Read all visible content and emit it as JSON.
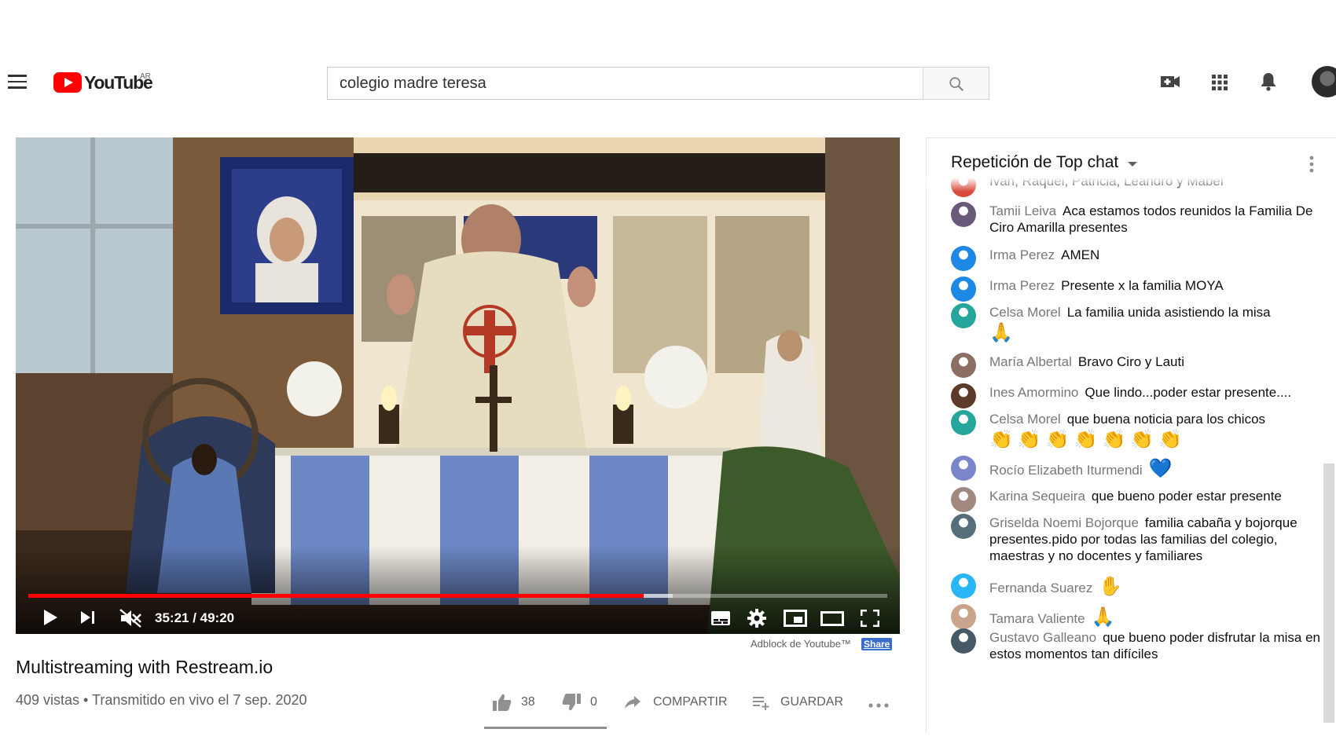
{
  "masthead": {
    "logo_text": "YouTube",
    "logo_country": "AR",
    "search_value": "colegio madre teresa"
  },
  "player": {
    "time_label": "35:21 / 49:20",
    "progress_fraction": 0.7166,
    "buffer_fraction": 0.75,
    "muted": true
  },
  "below_player": {
    "adblock_text": "Adblock de Youtube™",
    "share_text": "Share",
    "title": "Multistreaming with Restream.io",
    "meta": "409 vistas • Transmitido en vivo el 7 sep. 2020",
    "likes": "38",
    "dislikes": "0",
    "share_label": "COMPARTIR",
    "save_label": "GUARDAR"
  },
  "chat": {
    "title": "Repetición de Top chat",
    "messages": [
      {
        "author": "",
        "text": "Iván, Raquel, Patricia, Leandro y Mabel",
        "avatar_color": "#d84a3a",
        "emoji": ""
      },
      {
        "author": "Tamii Leiva",
        "text": "Aca estamos todos reunidos la Familia De Ciro Amarilla presentes",
        "avatar_color": "#6a5a7a",
        "emoji": ""
      },
      {
        "author": "Irma Perez",
        "text": "AMEN",
        "avatar_color": "#1e88e5",
        "emoji": ""
      },
      {
        "author": "Irma Perez",
        "text": "Presente x la familia MOYA",
        "avatar_color": "#1e88e5",
        "emoji": ""
      },
      {
        "author": "Celsa Morel",
        "text": "La familia unida asistiendo la misa",
        "avatar_color": "#26a69a",
        "emoji": "🙏"
      },
      {
        "author": "María Albertal",
        "text": "Bravo Ciro y Lauti",
        "avatar_color": "#8d6e63",
        "emoji": ""
      },
      {
        "author": "Ines Amormino",
        "text": "Que lindo...poder estar presente....",
        "avatar_color": "#5d3a2a",
        "emoji": ""
      },
      {
        "author": "Celsa Morel",
        "text": "que buena noticia para los chicos",
        "avatar_color": "#26a69a",
        "emoji": "👏👏👏👏👏👏👏"
      },
      {
        "author": "Rocío Elizabeth Iturmendi",
        "text": "",
        "avatar_color": "#7986cb",
        "emoji": "💙"
      },
      {
        "author": "Karina Sequeira",
        "text": "que bueno poder estar presente",
        "avatar_color": "#a1887f",
        "emoji": ""
      },
      {
        "author": "Griselda Noemi Bojorque",
        "text": "familia cabaña y bojorque presentes.pido por todas las familias del colegio, maestras y no docentes y familiares",
        "avatar_color": "#546e7a",
        "emoji": ""
      },
      {
        "author": "Fernanda Suarez",
        "text": "",
        "avatar_color": "#29b6f6",
        "emoji": "✋"
      },
      {
        "author": "Tamara Valiente",
        "text": "",
        "avatar_color": "#c9a38a",
        "emoji": "🙏"
      },
      {
        "author": "Gustavo Galleano",
        "text": "que bueno poder disfrutar la misa en estos momentos tan difíciles",
        "avatar_color": "#455a64",
        "emoji": ""
      }
    ]
  }
}
